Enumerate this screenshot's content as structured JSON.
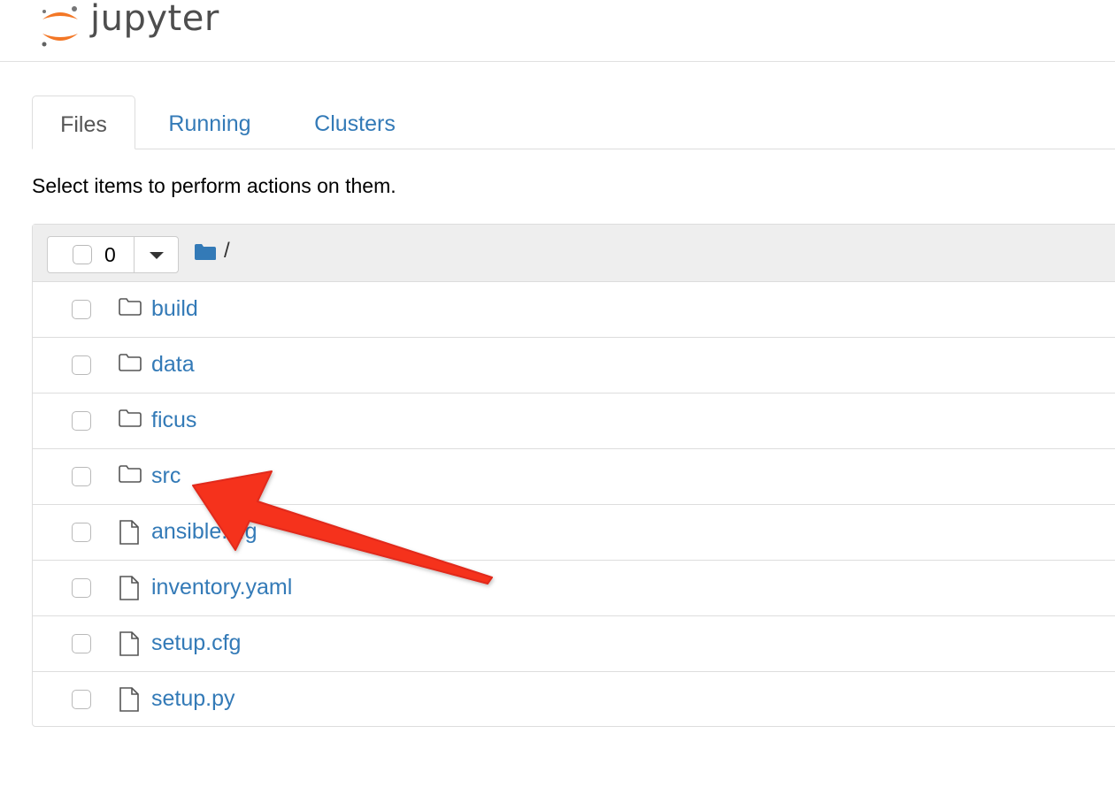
{
  "brand": {
    "name": "jupyter",
    "accent_orange": "#f37726",
    "text_gray": "#4e4e4e"
  },
  "tabs": [
    {
      "label": "Files",
      "active": true
    },
    {
      "label": "Running",
      "active": false
    },
    {
      "label": "Clusters",
      "active": false
    }
  ],
  "hint": "Select items to perform actions on them.",
  "toolbar": {
    "selected_count": "0",
    "path": "/",
    "path_icon": "folder-icon"
  },
  "files": [
    {
      "name": "build",
      "type": "folder"
    },
    {
      "name": "data",
      "type": "folder"
    },
    {
      "name": "ficus",
      "type": "folder"
    },
    {
      "name": "src",
      "type": "folder"
    },
    {
      "name": "ansible.cfg",
      "type": "file"
    },
    {
      "name": "inventory.yaml",
      "type": "file"
    },
    {
      "name": "setup.cfg",
      "type": "file"
    },
    {
      "name": "setup.py",
      "type": "file"
    }
  ],
  "annotation": {
    "type": "arrow",
    "color": "#f5301f",
    "points_to": "src"
  },
  "colors": {
    "link": "#337ab7",
    "border": "#dddddd",
    "header_bg": "#eeeeee"
  }
}
